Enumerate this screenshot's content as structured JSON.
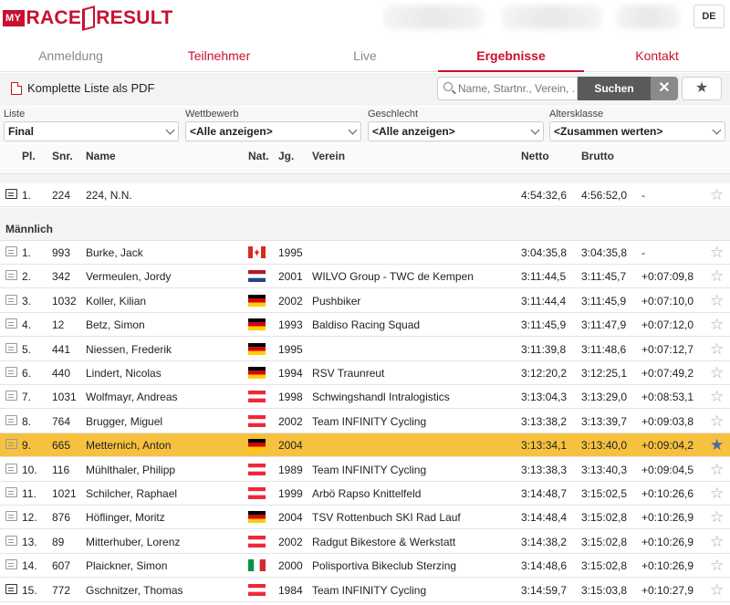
{
  "header": {
    "logo_my": "MY",
    "logo_race": "RACE",
    "logo_result": "RESULT",
    "lang": "DE"
  },
  "nav": {
    "tabs": [
      {
        "label": "Anmeldung"
      },
      {
        "label": "Teilnehmer"
      },
      {
        "label": "Live"
      },
      {
        "label": "Ergebnisse"
      },
      {
        "label": "Kontakt"
      }
    ],
    "active": "Ergebnisse"
  },
  "toolbar": {
    "pdf_label": "Komplette Liste als PDF",
    "search_placeholder": "Name, Startnr., Verein, ...",
    "search_button": "Suchen",
    "clear_button": "✕",
    "favorites_button": "★"
  },
  "filters": [
    {
      "label": "Liste",
      "value": "Final"
    },
    {
      "label": "Wettbewerb",
      "value": "<Alle anzeigen>"
    },
    {
      "label": "Geschlecht",
      "value": "<Alle anzeigen>"
    },
    {
      "label": "Altersklasse",
      "value": "<Zusammen werten>"
    }
  ],
  "columns": {
    "pl": "Pl.",
    "snr": "Snr.",
    "name": "Name",
    "nat": "Nat.",
    "jg": "Jg.",
    "verein": "Verein",
    "netto": "Netto",
    "brutto": "Brutto"
  },
  "top_row": {
    "pl": "1.",
    "snr": "224",
    "name": "224, N.N.",
    "jg": "",
    "verein": "",
    "netto": "4:54:32,6",
    "brutto": "4:56:52,0",
    "diff": "-"
  },
  "group_label": "Männlich",
  "colors": {
    "accent": "#c8102e",
    "highlight": "#f6c13e"
  },
  "rows": [
    {
      "pl": "1.",
      "snr": "993",
      "name": "Burke, Jack",
      "nat": "CAN",
      "jg": "1995",
      "verein": "",
      "netto": "3:04:35,8",
      "brutto": "3:04:35,8",
      "diff": "-"
    },
    {
      "pl": "2.",
      "snr": "342",
      "name": "Vermeulen, Jordy",
      "nat": "NED",
      "jg": "2001",
      "verein": "WILVO Group - TWC de Kempen",
      "netto": "3:11:44,5",
      "brutto": "3:11:45,7",
      "diff": "+0:07:09,8"
    },
    {
      "pl": "3.",
      "snr": "1032",
      "name": "Koller, Kilian",
      "nat": "GER",
      "jg": "2002",
      "verein": "Pushbiker",
      "netto": "3:11:44,4",
      "brutto": "3:11:45,9",
      "diff": "+0:07:10,0"
    },
    {
      "pl": "4.",
      "snr": "12",
      "name": "Betz, Simon",
      "nat": "GER",
      "jg": "1993",
      "verein": "Baldiso Racing Squad",
      "netto": "3:11:45,9",
      "brutto": "3:11:47,9",
      "diff": "+0:07:12,0"
    },
    {
      "pl": "5.",
      "snr": "441",
      "name": "Niessen, Frederik",
      "nat": "GER",
      "jg": "1995",
      "verein": "",
      "netto": "3:11:39,8",
      "brutto": "3:11:48,6",
      "diff": "+0:07:12,7"
    },
    {
      "pl": "6.",
      "snr": "440",
      "name": "Lindert, Nicolas",
      "nat": "GER",
      "jg": "1994",
      "verein": "RSV Traunreut",
      "netto": "3:12:20,2",
      "brutto": "3:12:25,1",
      "diff": "+0:07:49,2"
    },
    {
      "pl": "7.",
      "snr": "1031",
      "name": "Wolfmayr, Andreas",
      "nat": "AUT",
      "jg": "1998",
      "verein": "Schwingshandl Intralogistics",
      "netto": "3:13:04,3",
      "brutto": "3:13:29,0",
      "diff": "+0:08:53,1"
    },
    {
      "pl": "8.",
      "snr": "764",
      "name": "Brugger, Miguel",
      "nat": "AUT",
      "jg": "2002",
      "verein": "Team INFINITY Cycling",
      "netto": "3:13:38,2",
      "brutto": "3:13:39,7",
      "diff": "+0:09:03,8"
    },
    {
      "pl": "9.",
      "snr": "665",
      "name": "Metternich, Anton",
      "nat": "GER",
      "jg": "2004",
      "verein": "",
      "netto": "3:13:34,1",
      "brutto": "3:13:40,0",
      "diff": "+0:09:04,2"
    },
    {
      "pl": "10.",
      "snr": "116",
      "name": "Mühlthaler, Philipp",
      "nat": "AUT",
      "jg": "1989",
      "verein": "Team INFINITY Cycling",
      "netto": "3:13:38,3",
      "brutto": "3:13:40,3",
      "diff": "+0:09:04,5"
    },
    {
      "pl": "11.",
      "snr": "1021",
      "name": "Schilcher, Raphael",
      "nat": "AUT",
      "jg": "1999",
      "verein": "Arbö Rapso Knittelfeld",
      "netto": "3:14:48,7",
      "brutto": "3:15:02,5",
      "diff": "+0:10:26,6"
    },
    {
      "pl": "12.",
      "snr": "876",
      "name": "Höflinger, Moritz",
      "nat": "GER",
      "jg": "2004",
      "verein": "TSV Rottenbuch SKI Rad Lauf",
      "netto": "3:14:48,4",
      "brutto": "3:15:02,8",
      "diff": "+0:10:26,9"
    },
    {
      "pl": "13.",
      "snr": "89",
      "name": "Mitterhuber, Lorenz",
      "nat": "AUT",
      "jg": "2002",
      "verein": "Radgut Bikestore & Werkstatt",
      "netto": "3:14:38,2",
      "brutto": "3:15:02,8",
      "diff": "+0:10:26,9"
    },
    {
      "pl": "14.",
      "snr": "607",
      "name": "Plaickner, Simon",
      "nat": "ITA",
      "jg": "2000",
      "verein": "Polisportiva Bikeclub Sterzing",
      "netto": "3:14:48,6",
      "brutto": "3:15:02,8",
      "diff": "+0:10:26,9"
    },
    {
      "pl": "15.",
      "snr": "772",
      "name": "Gschnitzer, Thomas",
      "nat": "AUT",
      "jg": "1984",
      "verein": "Team INFINITY Cycling",
      "netto": "3:14:59,7",
      "brutto": "3:15:03,8",
      "diff": "+0:10:27,9"
    }
  ]
}
